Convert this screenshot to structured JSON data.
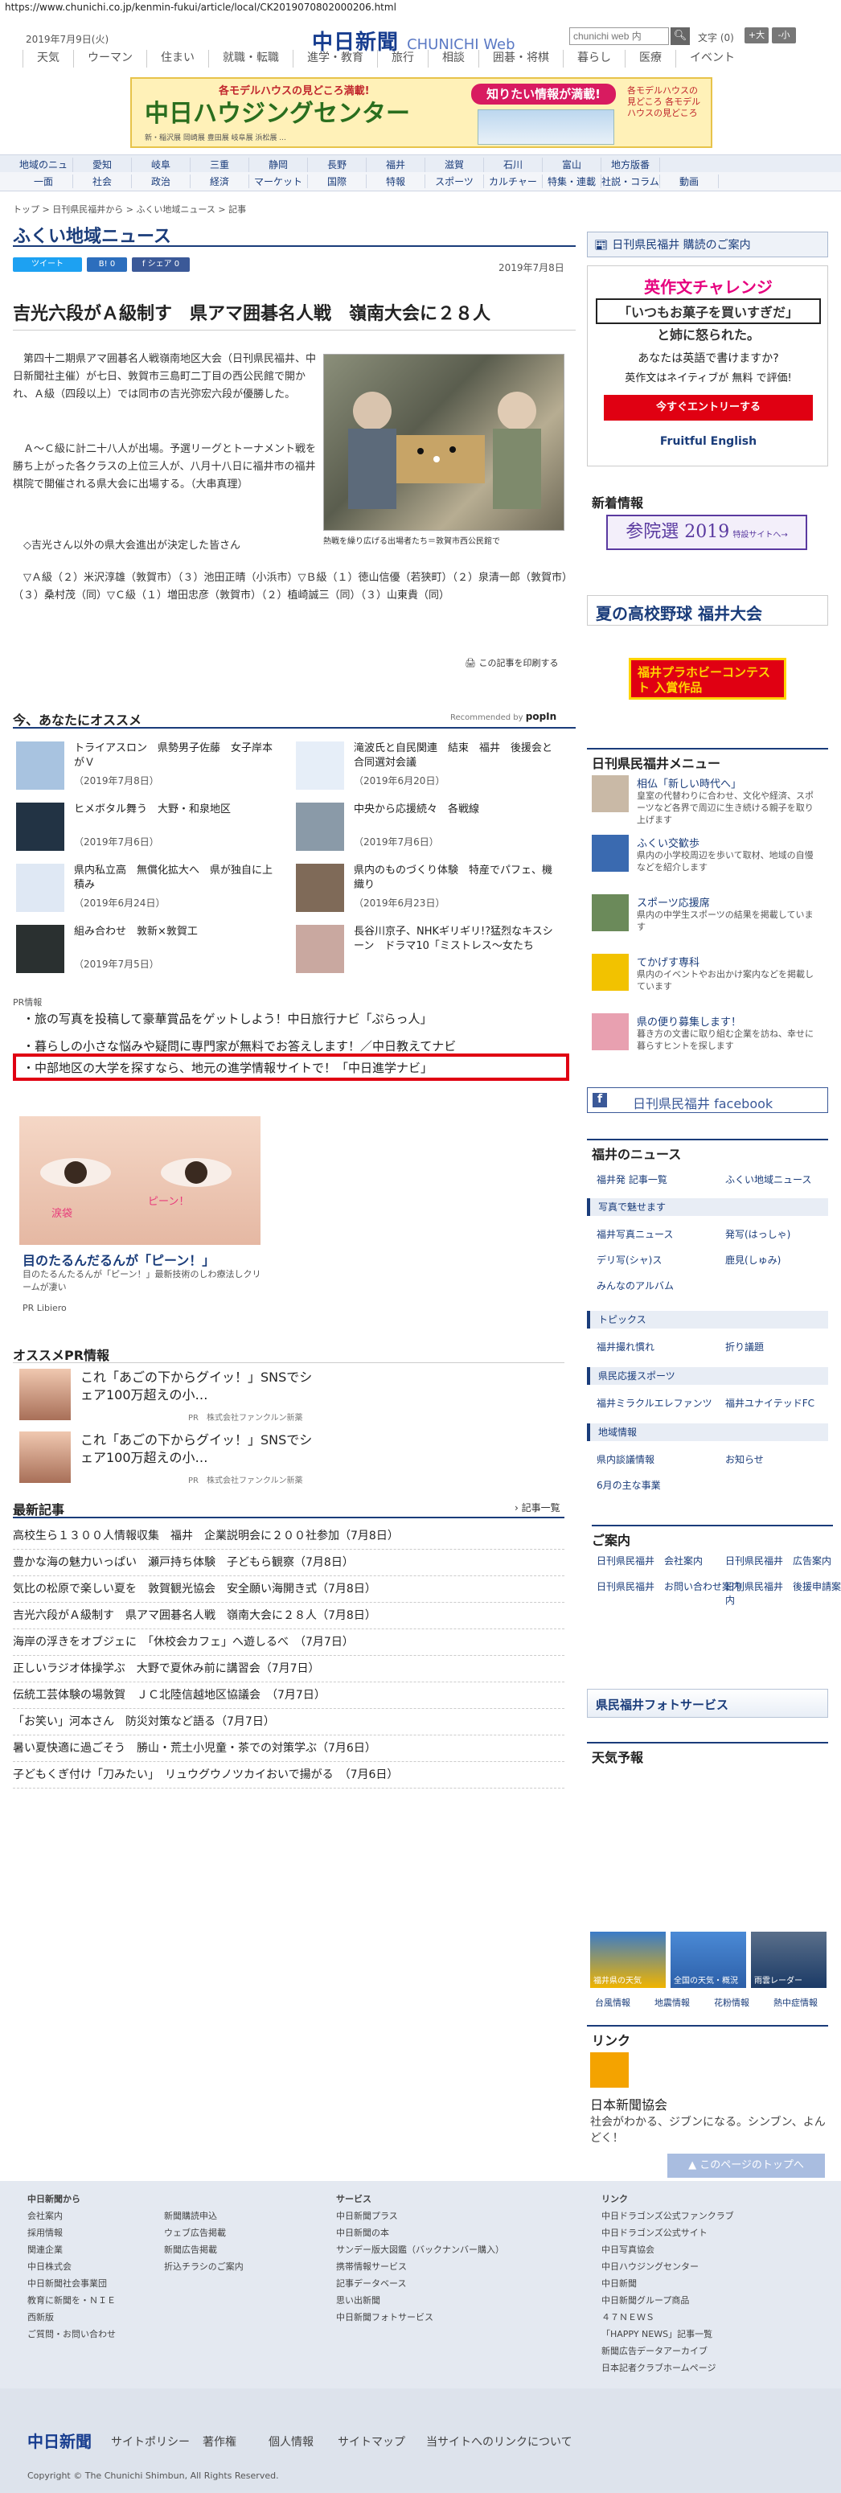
{
  "url": "https://www.chunichi.co.jp/kenmin-fukui/article/local/CK2019070802000206.html",
  "header": {
    "date": "2019年7月9日(火)",
    "logo": "中日新聞",
    "logo_sub": "CHUNICHI Web",
    "search_placeholder": "chunichi web 内",
    "font_size_label": "文字",
    "font_count": "(0)",
    "font_larger": "+大",
    "font_smaller": "-小"
  },
  "gnav": [
    "天気",
    "ウーマン",
    "住まい",
    "就職・転職",
    "進学・教育",
    "旅行",
    "相談",
    "囲碁・将棋",
    "暮らし",
    "医療",
    "イベント"
  ],
  "banner": {
    "title": "中日ハウジングセンター",
    "tagline": "各モデルハウスの見どころ満載!",
    "bubble": "知りたい情報が満載!",
    "side": "各モデルハウスの見どころ 各モデルハウスの見どころ",
    "places": "新・稲沢展 岡崎展 豊田展 岐阜展 浜松展 ..."
  },
  "regional_nav": [
    "地域のニュース",
    "愛知",
    "岐阜",
    "三重",
    "静岡",
    "長野",
    "福井",
    "滋賀",
    "石川",
    "富山",
    "地方版番"
  ],
  "category_nav": [
    "一面",
    "社会",
    "政治",
    "経済",
    "マーケット",
    "国際",
    "特報",
    "スポーツ",
    "カルチャー",
    "特集・連載",
    "社説・コラム",
    "動画"
  ],
  "breadcrumb": "トップ > 日刊県民福井から > ふくい地域ニュース > 記事",
  "section_title": "ふくい地域ニュース",
  "social": {
    "tweet": "ツイート",
    "hatena": "B! 0",
    "share": "f シェア 0"
  },
  "article": {
    "date": "2019年7月8日",
    "title": "吉光六段がＡ級制す　県アマ囲碁名人戦　嶺南大会に２８人",
    "p1": "　第四十二期県アマ囲碁名人戦嶺南地区大会（日刊県民福井、中日新聞社主催）が七日、敦賀市三島町二丁目の西公民館で開かれ、Ａ級（四段以上）では同市の吉光弥宏六段が優勝した。",
    "p2": "　Ａ～Ｃ級に計二十八人が出場。予選リーグとトーナメント戦を勝ち上がった各クラスの上位三人が、八月十八日に福井市の福井棋院で開催される県大会に出場する。（大串真理）",
    "p3": "　◇吉光さん以外の県大会進出が決定した皆さん",
    "p4": "　▽Ａ級（２）米沢淳雄（敦賀市）（３）池田正晴（小浜市）▽Ｂ級（１）徳山信優（若狭町）（２）泉清一郎（敦賀市）（３）桑村茂（同）▽Ｃ級（１）増田忠彦（敦賀市）（２）植崎誠三（同）（３）山東貴（同）",
    "caption": "熱戦を繰り広げる出場者たち＝敦賀市西公民館で",
    "print": "この記事を印刷する"
  },
  "reco": {
    "title": "今、あなたにオススメ",
    "by": "Recommended by",
    "brand": "popIn",
    "items": [
      {
        "title": "トライアスロン　県勢男子佐藤　女子岸本がＶ",
        "date": "（2019年7月8日）"
      },
      {
        "title": "滝波氏と自民関連　結束　福井　後援会と合同選対会議",
        "date": "（2019年6月20日）"
      },
      {
        "title": "ヒメボタル舞う　大野・和泉地区",
        "date": "（2019年7月6日）"
      },
      {
        "title": "中央から応援続々　各戦線",
        "date": "（2019年7月6日）"
      },
      {
        "title": "県内私立高　無償化拡大へ　県が独自に上積み",
        "date": "（2019年6月24日）"
      },
      {
        "title": "県内のものづくり体験　特産でパフェ、機織り",
        "date": "（2019年6月23日）"
      },
      {
        "title": "組み合わせ　敦新×敦賀工",
        "date": "（2019年7月5日）"
      },
      {
        "title": "長谷川京子、NHKギリギリ!?猛烈なキスシーン　ドラマ10「ミストレス～女たち",
        "date": ""
      }
    ]
  },
  "pr": {
    "label": "PR情報",
    "lines": [
      "・旅の写真を投稿して豪華賞品をゲットしよう！中日旅行ナビ「ぷらっ人」",
      "・暮らしの小さな悩みや疑問に専門家が無料でお答えします！／中日教えてナビ",
      "・中部地区の大学を探すなら、地元の進学情報サイトで！「中日進学ナビ」"
    ]
  },
  "ad": {
    "bubble1": "涙袋",
    "bubble2": "ピーン！",
    "title": "目のたるんだるんが「ピーン！」",
    "sub": "目のたるんたるんが「ピーン！」最新技術のしわ療法しクリームが凄い",
    "brand": "PR Libiero"
  },
  "prinfo": {
    "title": "オススメPR情報",
    "items": [
      {
        "text": "これ「あごの下からグイッ！」SNSでシェア100万超えの小…",
        "sponsor": "PR　株式会社ファンクルン新薬"
      },
      {
        "text": "これ「あごの下からグイッ！」SNSでシェア100万超えの小…",
        "sponsor": "PR　株式会社ファンクルン新薬"
      }
    ]
  },
  "latest": {
    "title": "最新記事",
    "all": "記事一覧",
    "items": [
      "高校生ら１３００人情報収集　福井　企業説明会に２００社参加（7月8日）",
      "豊かな海の魅力いっぱい　瀬戸持ち体験　子どもら観察（7月8日）",
      "気比の松原で楽しい夏を　敦賀観光協会　安全願い海開き式（7月8日）",
      "吉光六段がＡ級制す　県アマ囲碁名人戦　嶺南大会に２８人（7月8日）",
      "海岸の浮きをオブジェに　「休校会カフェ」へ遊しるべ　（7月7日）",
      "正しいラジオ体操学ぶ　大野で夏休み前に講習会（7月7日）",
      "伝統工芸体験の場敦賀　ＪＣ北陸信越地区協議会　（7月7日）",
      "「お笑い」河本さん　防災対策など語る（7月7日）",
      "暑い夏快適に過ごそう　勝山・荒土小児童・茶での対策学ぶ（7月6日）",
      "子どもくぎ付け「刀みたい」　リュウグウノツカイおいで揚がる　（7月6日）"
    ]
  },
  "side": {
    "subscribe": "日刊県民福井 購読のご案内",
    "ad": {
      "title": "英作文チャレンジ",
      "quote": "「いつもお菓子を買いすぎだ」",
      "quote2": "と姉に怒られた。",
      "q": "あなたは英語で書けますか?",
      "q2": "英作文はネイティブが 無料 で評価!",
      "cta": "今すぐエントリーする",
      "brand": "Fruitful English"
    },
    "new_info": "新着情報",
    "sanin": "参院選 2019",
    "sanin_sub": "特設サイトへ→",
    "koushien": "夏の高校野球 福井大会",
    "hobby": "福井プラホビーコンテスト 入賞作品",
    "menu_title": "日刊県民福井メニュー",
    "menu": [
      {
        "t": "相仏「新しい時代へ」",
        "d": "皇室の代替わりに合わせ、文化や経済、スポーツなど各界で周辺に生き続ける親子を取り上げます"
      },
      {
        "t": "ふくい交歓歩",
        "d": "県内の小学校周辺を歩いて取材、地域の自慢などを紹介します"
      },
      {
        "t": "スポーツ応援席",
        "d": "県内の中学生スポーツの結果を掲載しています"
      },
      {
        "t": "てかげす専科",
        "d": "県内のイベントやお出かけ案内などを掲載しています"
      },
      {
        "t": "県の便り募集します！",
        "d": "暮き方の文書に取り組む企業を訪ね、幸せに暮らすヒントを探します"
      }
    ],
    "facebook": "日刊県民福井 facebook",
    "fukui_news": "福井のニュース",
    "news_links": [
      "福井発 記事一覧",
      "ふくい地域ニュース"
    ],
    "photo_head": "写真で魅せます",
    "photo_links": [
      "福井写真ニュース",
      "発写(はっしゃ)",
      "デリ写(シャ)ス",
      "鹿見(しゅみ)",
      "みんなのアルバム"
    ],
    "topics_head": "トピックス",
    "topics_links": [
      "福井撮れ慣れ",
      "折り議題"
    ],
    "sports_head": "県民応援スポーツ",
    "sports_links": [
      "福井ミラクルエレファンツ",
      "福井ユナイテッドFC"
    ],
    "region_head": "地域情報",
    "region_links": [
      "県内談議情報",
      "お知らせ",
      "6月の主な事業"
    ],
    "guide_head": "ご案内",
    "guide_links": [
      "日刊県民福井　会社案内",
      "日刊県民福井　広告案内",
      "日刊県民福井　お問い合わせ案内",
      "日刊県民福井　後援申請案内"
    ],
    "photoservice": "県民福井フォトサービス",
    "weather_head": "天気予報",
    "weather": [
      "福井県の天気",
      "全国の天気・概況",
      "雨雲レーダー"
    ],
    "weather_links": [
      "台風情報",
      "地震情報",
      "花粉情報",
      "熱中症情報"
    ],
    "link_head": "リンク",
    "link_name": "日本新聞協会",
    "link_desc": "社会がわかる、ジブンになる。シンブン、よんどく！"
  },
  "pagetop": "▲ このページのトップへ",
  "footer": {
    "col1_head": "中日新聞から",
    "col1": [
      "会社案内",
      "採用情報",
      "関連企業",
      "中日株式会",
      "中日新聞社会事業団",
      "教育に新聞を・ＮＩＥ",
      "西新版",
      "ご質問・お問い合わせ"
    ],
    "col2": [
      "新聞購読申込",
      "ウェブ広告掲載",
      "新聞広告掲載",
      "折込チラシのご案内"
    ],
    "col3_head": "サービス",
    "col3": [
      "中日新聞プラス",
      "中日新聞の本",
      "サンデー版大図鑑（バックナンバー購入）",
      "携帯情報サービス",
      "記事データベース",
      "思い出新聞",
      "中日新聞フォトサービス"
    ],
    "col4_head": "リンク",
    "col4": [
      "中日ドラゴンズ公式ファンクラブ",
      "中日ドラゴンズ公式サイト",
      "中日写真協会",
      "中日ハウジングセンター",
      "中日新聞",
      "中日新聞グループ商品",
      "４７ＮＥＷＳ",
      "「HAPPY NEWS」記事一覧",
      "新聞広告データアーカイブ",
      "日本記者クラブホームページ"
    ]
  },
  "bottom": {
    "logo": "中日新聞",
    "links": [
      "サイトポリシー",
      "著作権",
      "個人情報",
      "サイトマップ",
      "当サイトへのリンクについて"
    ],
    "copyright": "Copyright © The Chunichi Shimbun, All Rights Reserved."
  },
  "colors": {
    "brand": "#1a3c7a",
    "highlight": "#e00012"
  }
}
